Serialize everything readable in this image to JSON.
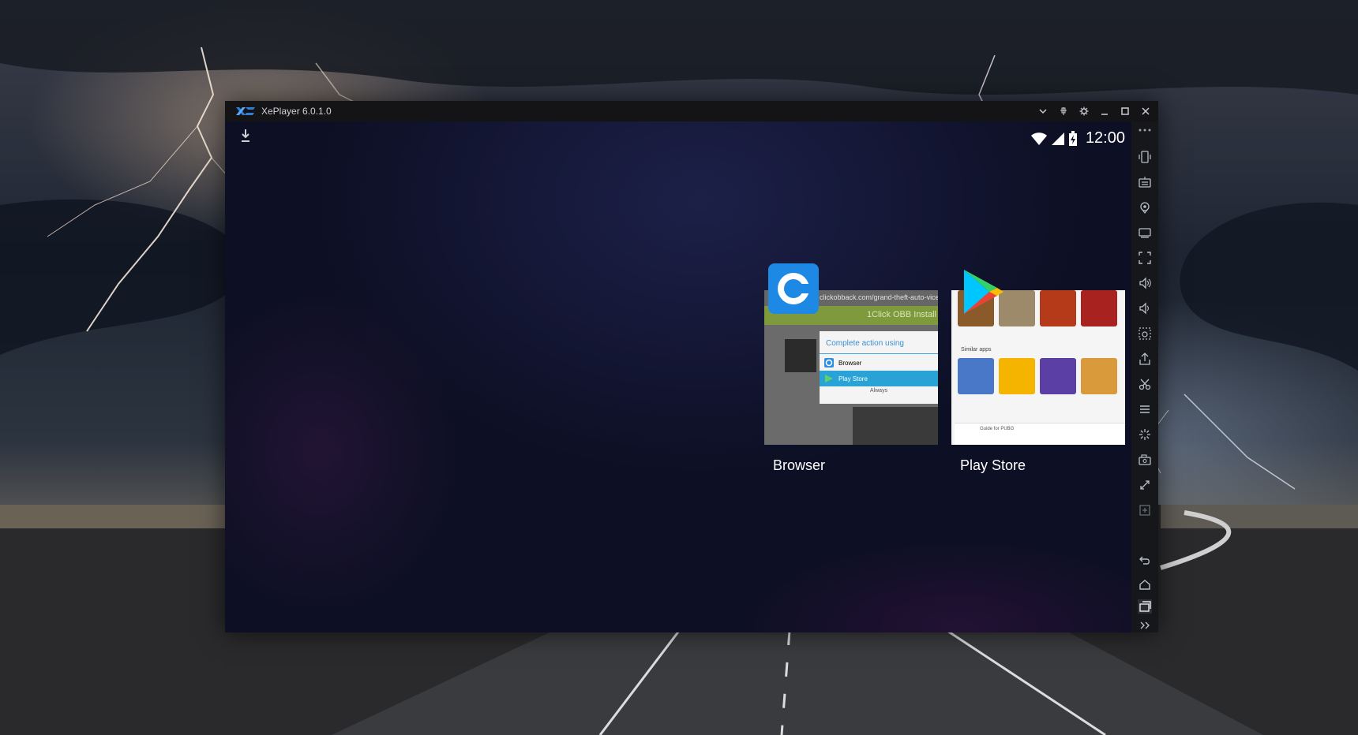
{
  "window": {
    "title": "XePlayer 6.0.1.0"
  },
  "status_bar": {
    "time": "12:00"
  },
  "recents": [
    {
      "label": "Browser",
      "thumbnail": {
        "url": "clickobback.com/grand-theft-auto-vice-city",
        "header": "1Click OBB Install",
        "dialog_title": "Complete action using",
        "options": [
          "Browser",
          "Play Store"
        ],
        "always": "Always"
      }
    },
    {
      "label": "Play Store",
      "thumbnail": {
        "section": "Similar apps",
        "banner": "Guide for PUBG"
      }
    }
  ],
  "sidebar_icons": [
    "phone-shake-icon",
    "keyboard-icon",
    "location-icon",
    "screen-icon",
    "fullscreen-icon",
    "volume-up-icon",
    "volume-down-icon",
    "screenshot-icon",
    "apk-install-icon",
    "scissors-icon",
    "menu-icon",
    "loading-icon",
    "camera-icon",
    "resize-icon",
    "multi-instance-icon",
    "back-icon",
    "home-icon",
    "recents-icon",
    "expand-icon"
  ],
  "colors": {
    "titlebar": "#141416",
    "screen": "#0d0f24",
    "sidebar": "#16171a",
    "dialog_accent": "#3fa7dd",
    "selected_option": "#29a3d6"
  }
}
